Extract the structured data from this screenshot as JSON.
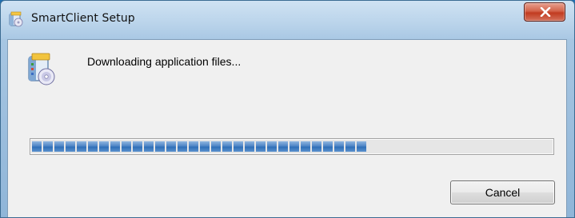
{
  "window": {
    "title": "SmartClient Setup",
    "app_icon": "setup-icon",
    "close_icon": "close-icon"
  },
  "content": {
    "icon": "setup-package-icon",
    "message": "Downloading application files...",
    "progress": {
      "fraction": 0.75,
      "filled_segments": 30,
      "total_segments": 40,
      "color": "#2f6fb8"
    }
  },
  "buttons": {
    "cancel_label": "Cancel"
  }
}
